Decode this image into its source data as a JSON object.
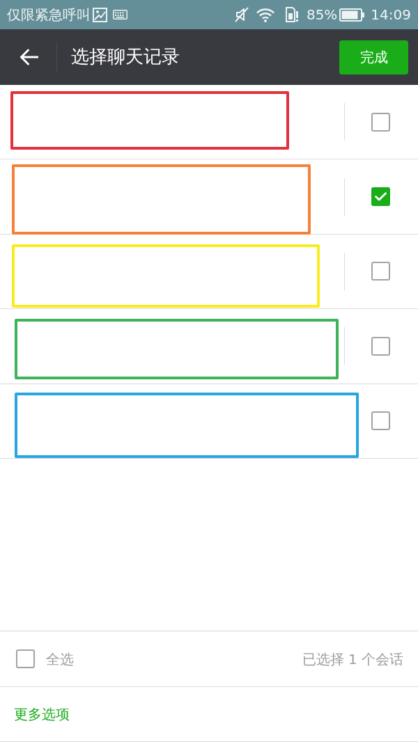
{
  "status_bar": {
    "carrier": "仅限紧急呼叫",
    "battery": "85%",
    "time": "14:09"
  },
  "app_bar": {
    "title": "选择聊天记录",
    "done_button": "完成"
  },
  "rows": [
    {
      "color": "#e2313f",
      "checked": false
    },
    {
      "color": "#f5813a",
      "checked": true
    },
    {
      "color": "#f8ec1e",
      "checked": false
    },
    {
      "color": "#3db35b",
      "checked": false
    },
    {
      "color": "#27a6e0",
      "checked": false
    }
  ],
  "footer": {
    "select_all": {
      "label": "全选",
      "checked": false
    },
    "selection_count": "已选择 1 个会话",
    "more_options": "更多选项"
  }
}
